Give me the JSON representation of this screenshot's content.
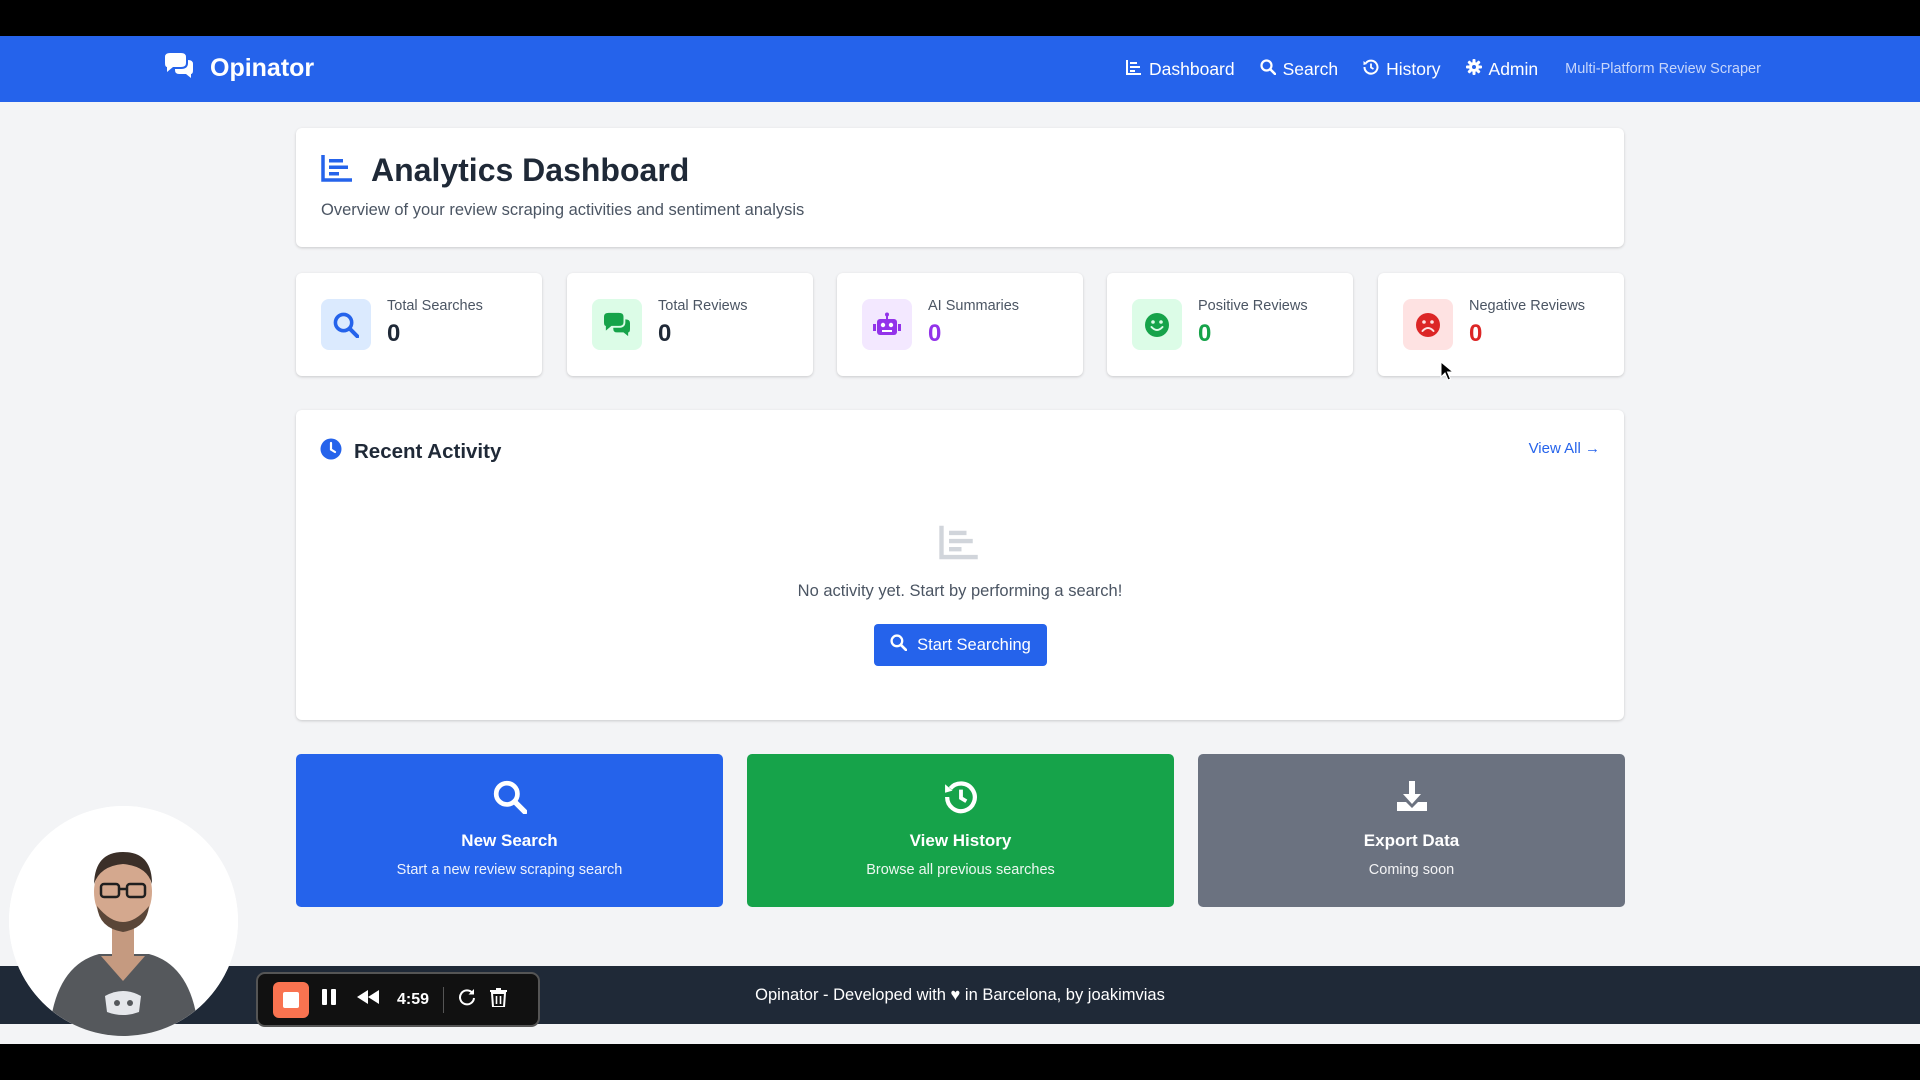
{
  "nav": {
    "brand": "Opinator",
    "links": [
      {
        "label": "Dashboard",
        "icon": "chart-icon"
      },
      {
        "label": "Search",
        "icon": "search-icon"
      },
      {
        "label": "History",
        "icon": "history-icon"
      },
      {
        "label": "Admin",
        "icon": "gear-icon"
      }
    ],
    "tagline": "Multi-Platform Review Scraper"
  },
  "header": {
    "title": "Analytics Dashboard",
    "subtitle": "Overview of your review scraping activities and sentiment analysis"
  },
  "stats": [
    {
      "label": "Total Searches",
      "value": "0",
      "icon": "search-icon",
      "color": "#2563eb",
      "bg": "#dbeafe",
      "value_color": "#1f2937"
    },
    {
      "label": "Total Reviews",
      "value": "0",
      "icon": "comments-icon",
      "color": "#16a34a",
      "bg": "#dcfce7",
      "value_color": "#1f2937"
    },
    {
      "label": "AI Summaries",
      "value": "0",
      "icon": "robot-icon",
      "color": "#9333ea",
      "bg": "#f3e8ff",
      "value_color": "#9333ea"
    },
    {
      "label": "Positive Reviews",
      "value": "0",
      "icon": "smile-icon",
      "color": "#16a34a",
      "bg": "#dcfce7",
      "value_color": "#16a34a"
    },
    {
      "label": "Negative Reviews",
      "value": "0",
      "icon": "frown-icon",
      "color": "#dc2626",
      "bg": "#fee2e2",
      "value_color": "#dc2626"
    }
  ],
  "activity": {
    "title": "Recent Activity",
    "view_all": "View All →",
    "empty_text": "No activity yet. Start by performing a search!",
    "button": "Start Searching"
  },
  "actions": [
    {
      "title": "New Search",
      "subtitle": "Start a new review scraping search",
      "icon": "search-icon",
      "color": "#2563eb"
    },
    {
      "title": "View History",
      "subtitle": "Browse all previous searches",
      "icon": "history-icon",
      "color": "#16a34a"
    },
    {
      "title": "Export Data",
      "subtitle": "Coming soon",
      "icon": "download-icon",
      "color": "#6b7280"
    }
  ],
  "footer": {
    "text": "Opinator - Developed with ♥ in Barcelona, by joakimvias"
  },
  "recorder": {
    "time": "4:59"
  }
}
